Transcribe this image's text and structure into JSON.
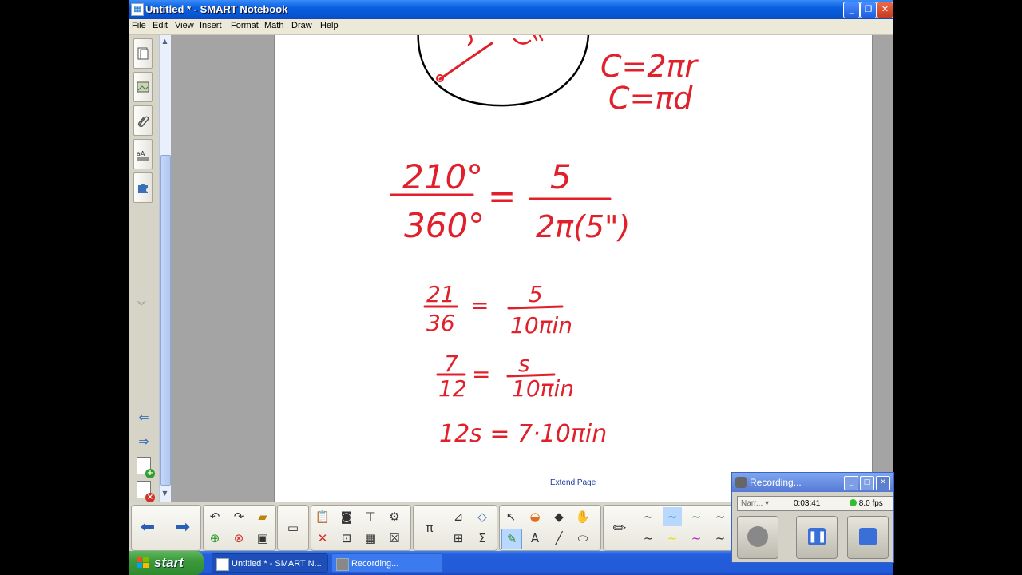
{
  "window": {
    "title": "Untitled * - SMART Notebook",
    "app_icon": "notebook-icon"
  },
  "menu": [
    "File",
    "Edit",
    "View",
    "Insert",
    "Format",
    "Math",
    "Draw",
    "Help"
  ],
  "sidebar": {
    "tabs": [
      {
        "name": "page-sorter",
        "icon": "page-sorter-icon"
      },
      {
        "name": "gallery",
        "icon": "gallery-icon"
      },
      {
        "name": "attachments",
        "icon": "paperclip-icon"
      },
      {
        "name": "properties",
        "icon": "properties-icon"
      },
      {
        "name": "addons",
        "icon": "puzzle-icon"
      }
    ]
  },
  "canvas": {
    "extend_label": "Extend Page",
    "ink_color": "#e0202a",
    "formulas": [
      "C=2πr",
      "C=πd"
    ],
    "eq1": {
      "num_l": "210°",
      "den_l": "360°",
      "num_r": "5",
      "den_r": "2π(5\")"
    },
    "eq2": {
      "num_l": "21",
      "den_l": "36",
      "num_r": "5",
      "den_r": "10πin"
    },
    "eq3": {
      "num_l": "7",
      "den_l": "12",
      "num_r": "s",
      "den_r": "10πin"
    },
    "eq4": "12s = 7·10πin"
  },
  "taskbar": {
    "start_label": "start",
    "tasks": [
      "Untitled * - SMART N...",
      "Recording..."
    ]
  },
  "recording": {
    "title": "Recording...",
    "source": "Narr...",
    "time": "0:03:41",
    "fps": "8.0 fps",
    "status_color": "#2fbf2f"
  }
}
